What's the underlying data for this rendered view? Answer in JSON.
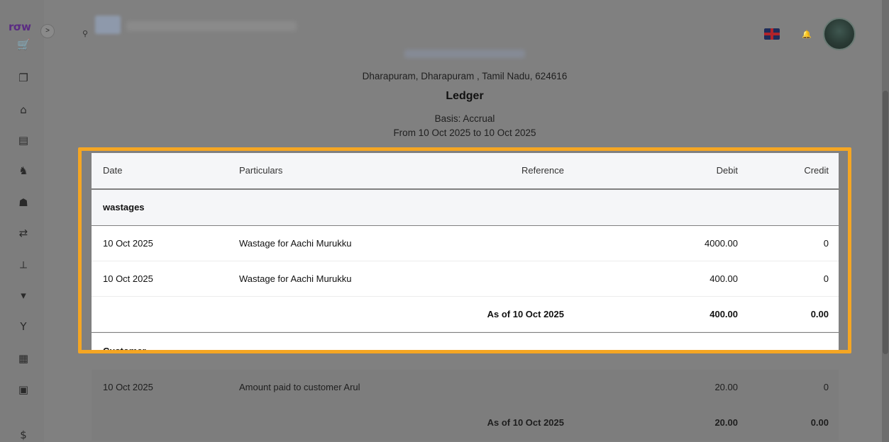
{
  "app": {
    "logo_text": "rσw",
    "collapse_icon": "chevron-right-icon"
  },
  "sidebar": {
    "items": [
      {
        "icon": "cart-icon"
      },
      {
        "icon": "copy-icon"
      },
      {
        "icon": "bank-icon"
      },
      {
        "icon": "book-icon"
      },
      {
        "icon": "user-check-icon"
      },
      {
        "icon": "users-icon"
      },
      {
        "icon": "transfer-icon"
      },
      {
        "icon": "chart-icon"
      },
      {
        "icon": "trash-icon"
      },
      {
        "icon": "filter-icon"
      },
      {
        "icon": "calculator-icon"
      },
      {
        "icon": "contact-icon"
      },
      {
        "icon": "money-icon"
      }
    ]
  },
  "topbar": {
    "search_icon": "search-icon",
    "flag_icon": "uk-flag-icon",
    "bell_icon": "bell-icon"
  },
  "report": {
    "address": "Dharapuram, Dharapuram , Tamil Nadu, 624616",
    "title": "Ledger",
    "basis": "Basis: Accrual",
    "range": "From 10 Oct 2025 to 10 Oct 2025"
  },
  "table": {
    "headers": {
      "date": "Date",
      "particulars": "Particulars",
      "reference": "Reference",
      "debit": "Debit",
      "credit": "Credit"
    },
    "group1": {
      "name": "wastages",
      "rows": [
        {
          "date": "10 Oct 2025",
          "particulars": "Wastage for Aachi Murukku",
          "reference": "",
          "debit": "4000.00",
          "credit": "0"
        },
        {
          "date": "10 Oct 2025",
          "particulars": "Wastage for Aachi Murukku",
          "reference": "",
          "debit": "400.00",
          "credit": "0"
        }
      ],
      "total": {
        "label": "As of 10 Oct 2025",
        "debit": "400.00",
        "credit": "0.00"
      }
    },
    "group2": {
      "name": "Customer",
      "rows": [
        {
          "date": "10 Oct 2025",
          "particulars": "Amount paid to customer Arul",
          "reference": "",
          "debit": "20.00",
          "credit": "0"
        }
      ],
      "total": {
        "label": "As of 10 Oct 2025",
        "debit": "20.00",
        "credit": "0.00"
      }
    }
  },
  "colors": {
    "highlight": "#f5a623",
    "overlay": "#808080"
  }
}
